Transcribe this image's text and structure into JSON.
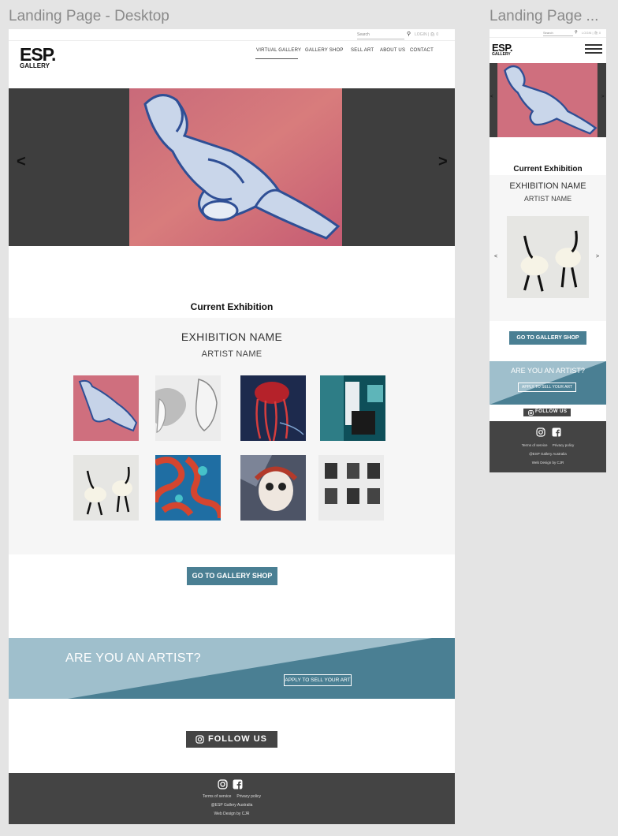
{
  "frames": {
    "desktop_label": "Landing Page - Desktop",
    "mobile_label": "Landing Page ..."
  },
  "desktop": {
    "search_placeholder": "Search",
    "login": "LOGIN | 🛍 0",
    "logo_main": "ESP.",
    "logo_sub": "GALLERY",
    "nav": [
      "VIRTUAL GALLERY",
      "GALLERY SHOP",
      "SELL ART",
      "ABOUT US",
      "CONTACT"
    ],
    "hero_prev": "<",
    "hero_next": ">",
    "current_exhibition": "Current Exhibition",
    "exhibition_name": "EXHIBITION NAME",
    "artist_name": "ARTIST NAME",
    "gallery_shop_button": "GO TO GALLERY SHOP",
    "artist_question": "ARE YOU AN ARTIST?",
    "apply_button": "APPLY TO SELL YOUR ART",
    "follow_button": "FOLLOW US",
    "footer": {
      "terms": "Terms of service",
      "privacy": "Privacy policy",
      "copyright": "@ESP Gallery Australia",
      "credit": "Web Design by CJR"
    }
  },
  "mobile": {
    "search_placeholder": "Search",
    "login": "LOGIN | 🛍 0",
    "logo_main": "ESP.",
    "logo_sub": "GALLERY",
    "hero_prev": "<",
    "hero_next": ">",
    "current_exhibition": "Current Exhibition",
    "exhibition_name": "EXHIBITION NAME",
    "artist_name": "ARTIST NAME",
    "carousel_prev": "<",
    "carousel_next": ">",
    "gallery_shop_button": "GO TO GALLERY SHOP",
    "artist_question": "ARE YOU AN ARTIST?",
    "apply_button": "APPLY TO SELL YOUR ART",
    "follow_button": "FOLLOW US",
    "footer": {
      "terms": "Terms of service",
      "privacy": "Privacy policy",
      "copyright": "@ESP Gallery Australia",
      "credit": "Web Design by CJR"
    }
  },
  "colors": {
    "accent": "#4a7f93",
    "banner_light": "#9fbfcc",
    "banner_dark": "#4a7f93",
    "dark": "#444444",
    "hero_bg": "#3e3e3e"
  },
  "icons": [
    "search-icon",
    "cart-icon",
    "instagram-icon",
    "facebook-icon",
    "hamburger-menu-icon",
    "chevron-left-icon",
    "chevron-right-icon"
  ]
}
